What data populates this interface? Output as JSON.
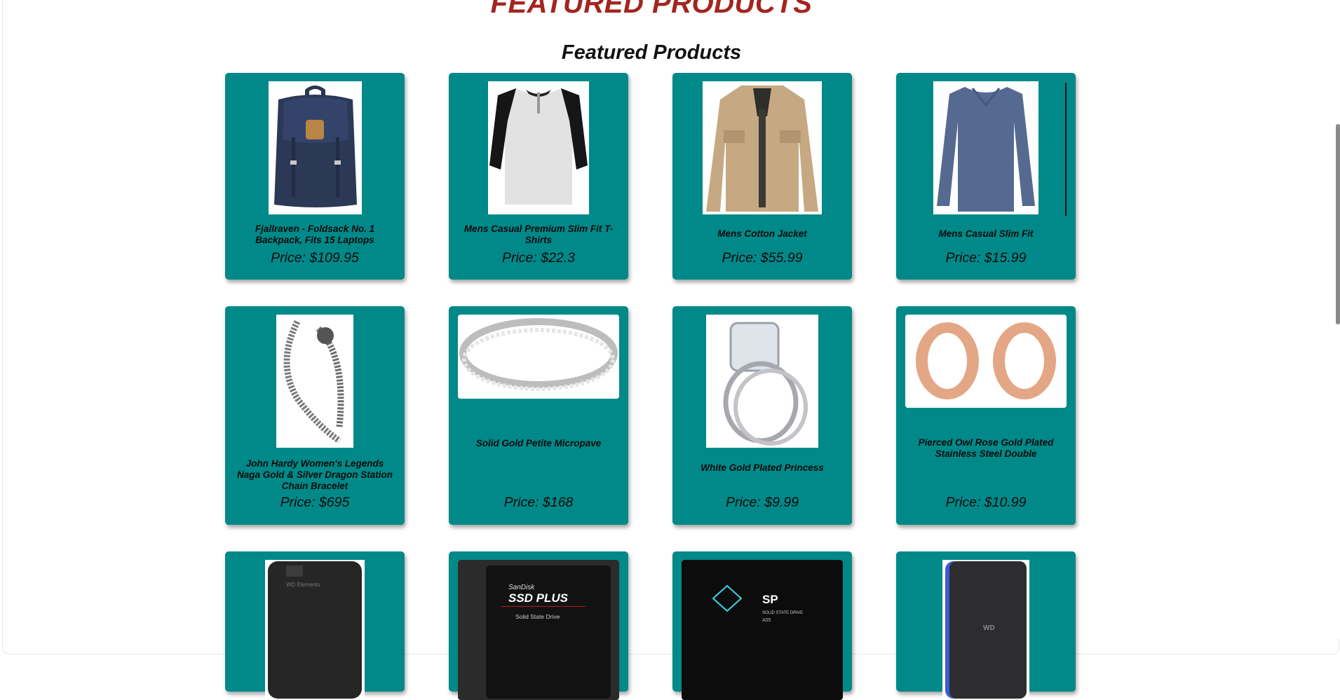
{
  "header": {
    "banner": "FEATURED PRODUCTS",
    "title": "Featured Products"
  },
  "products": [
    {
      "name": "Fjallraven - Foldsack No. 1 Backpack, Fits 15 Laptops",
      "price": "Price: $109.95",
      "icon": "backpack-icon"
    },
    {
      "name": "Mens Casual Premium Slim Fit T-Shirts",
      "price": "Price: $22.3",
      "icon": "tshirt-icon"
    },
    {
      "name": "Mens Cotton Jacket",
      "price": "Price: $55.99",
      "icon": "jacket-icon"
    },
    {
      "name": "Mens Casual Slim Fit",
      "price": "Price: $15.99",
      "icon": "longsleeve-shirt-icon"
    },
    {
      "name": "John Hardy Women's Legends Naga Gold & Silver Dragon Station Chain Bracelet",
      "price": "Price: $695",
      "icon": "bracelet-icon"
    },
    {
      "name": "Solid Gold Petite Micropave",
      "price": "Price: $168",
      "icon": "ring-icon"
    },
    {
      "name": "White Gold Plated Princess",
      "price": "Price: $9.99",
      "icon": "engagement-ring-icon"
    },
    {
      "name": "Pierced Owl Rose Gold Plated Stainless Steel Double",
      "price": "Price: $10.99",
      "icon": "ear-tunnel-icon"
    },
    {
      "name": "",
      "price": "",
      "icon": "hard-drive-icon",
      "brand": "WD Elements"
    },
    {
      "name": "",
      "price": "",
      "icon": "ssd-icon",
      "brand": "SanDisk",
      "model": "SSD PLUS",
      "sub": "Solid State Drive"
    },
    {
      "name": "",
      "price": "",
      "icon": "ssd-icon",
      "brand": "SP",
      "sub": "SOLID STATE DRIVE",
      "model": "A55"
    },
    {
      "name": "",
      "price": "",
      "icon": "portable-drive-icon",
      "brand": "WD"
    }
  ],
  "colors": {
    "card": "#018989",
    "banner": "#a3251f"
  }
}
